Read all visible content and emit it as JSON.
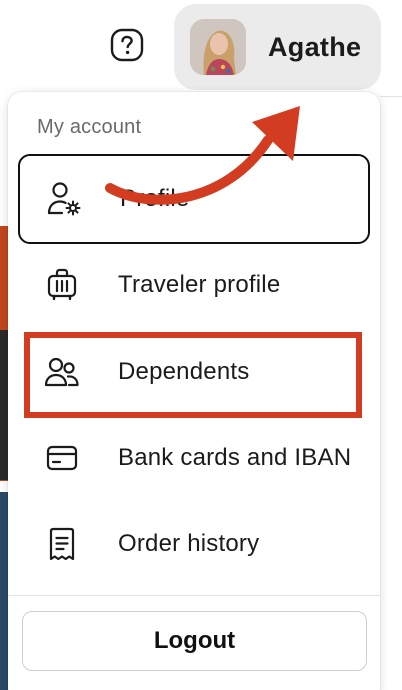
{
  "header": {
    "help_icon": "question-circle-icon",
    "user_name": "Agathe",
    "avatar": "user-photo"
  },
  "menu": {
    "heading": "My account",
    "items": [
      {
        "label": "Profile",
        "icon": "user-gear-icon"
      },
      {
        "label": "Traveler profile",
        "icon": "luggage-icon"
      },
      {
        "label": "Dependents",
        "icon": "people-icon"
      },
      {
        "label": "Bank cards and IBAN",
        "icon": "credit-card-icon"
      },
      {
        "label": "Order history",
        "icon": "receipt-icon"
      }
    ],
    "logout_label": "Logout"
  },
  "annotations": {
    "highlight_color": "#d23c20",
    "arrow_color": "#d23c20"
  }
}
